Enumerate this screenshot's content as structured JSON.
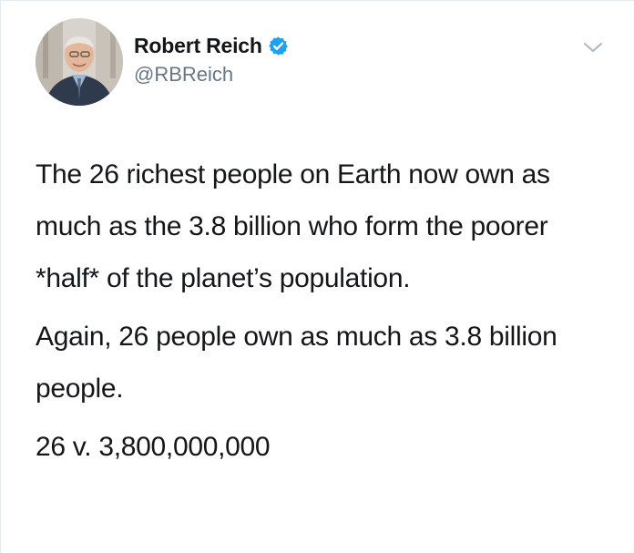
{
  "tweet": {
    "author": {
      "display_name": "Robert Reich",
      "handle": "@RBReich",
      "verified": true,
      "avatar_icon": "user-avatar-photo"
    },
    "menu_icon": "chevron-down-icon",
    "paragraphs": [
      "The 26 richest people on Earth now own as much as the 3.8 billion who form the poorer *half* of the planet’s population.",
      "Again, 26 people own as much as 3.8 billion people.",
      "26 v. 3,800,000,000"
    ]
  },
  "colors": {
    "text_primary": "#14171a",
    "text_secondary": "#657786",
    "verified_blue": "#1da1f2",
    "chevron_gray": "#aab8c2"
  }
}
